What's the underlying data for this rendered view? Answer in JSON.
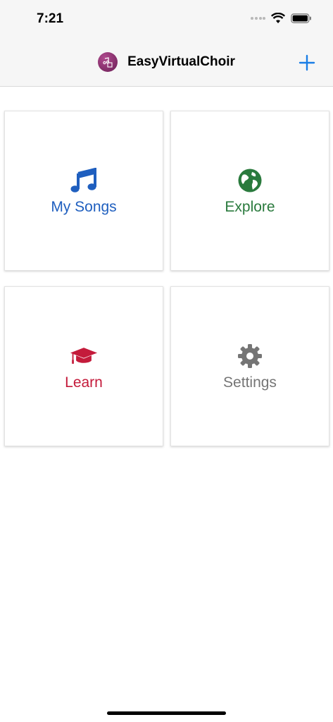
{
  "status": {
    "time": "7:21"
  },
  "header": {
    "title": "EasyVirtualChoir"
  },
  "tiles": [
    {
      "label": "My Songs",
      "icon": "music-note-icon",
      "color": "#1f5fbf"
    },
    {
      "label": "Explore",
      "icon": "globe-icon",
      "color": "#2a7a3d"
    },
    {
      "label": "Learn",
      "icon": "graduation-cap-icon",
      "color": "#c41b3b"
    },
    {
      "label": "Settings",
      "icon": "gear-icon",
      "color": "#757575"
    }
  ],
  "colors": {
    "accent": "#1a7ee6",
    "nav_background": "#f6f6f6"
  }
}
